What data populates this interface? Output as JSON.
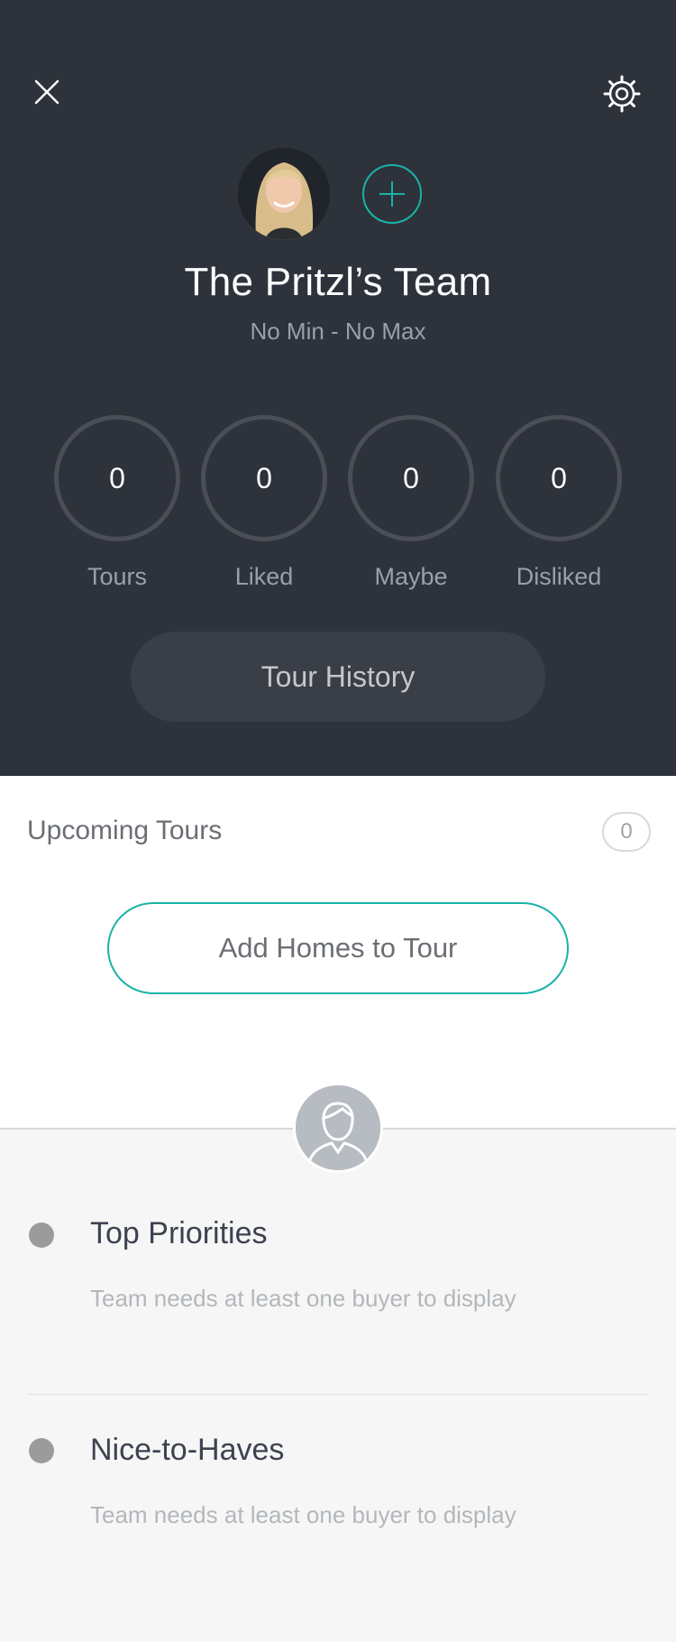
{
  "header": {
    "team_name": "The Pritzl’s Team",
    "price_range": "No Min - No Max",
    "stats": [
      {
        "value": "0",
        "label": "Tours"
      },
      {
        "value": "0",
        "label": "Liked"
      },
      {
        "value": "0",
        "label": "Maybe"
      },
      {
        "value": "0",
        "label": "Disliked"
      }
    ],
    "tour_history_label": "Tour History",
    "icons": {
      "close": "close-icon",
      "settings": "gear-icon",
      "add": "plus-icon"
    },
    "accent_color": "#19b3a6"
  },
  "upcoming": {
    "title": "Upcoming Tours",
    "count": "0",
    "add_homes_label": "Add Homes to Tour"
  },
  "priorities": [
    {
      "title": "Top Priorities",
      "empty_text": "Team needs at least one buyer to display"
    },
    {
      "title": "Nice-to-Haves",
      "empty_text": "Team needs at least one buyer to display"
    }
  ]
}
